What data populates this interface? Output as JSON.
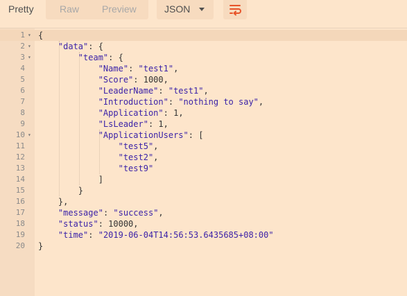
{
  "toolbar": {
    "tabs": [
      "Pretty",
      "Raw",
      "Preview"
    ],
    "format": "JSON",
    "wrap_icon": "wrap-lines-icon"
  },
  "lines": [
    {
      "n": "1",
      "fold": true,
      "text": "{"
    },
    {
      "n": "2",
      "fold": true,
      "text": "    \"data\": {"
    },
    {
      "n": "3",
      "fold": true,
      "text": "        \"team\": {"
    },
    {
      "n": "4",
      "fold": false,
      "text": "            \"Name\": \"test1\","
    },
    {
      "n": "5",
      "fold": false,
      "text": "            \"Score\": 1000,"
    },
    {
      "n": "6",
      "fold": false,
      "text": "            \"LeaderName\": \"test1\","
    },
    {
      "n": "7",
      "fold": false,
      "text": "            \"Introduction\": \"nothing to say\","
    },
    {
      "n": "8",
      "fold": false,
      "text": "            \"Application\": 1,"
    },
    {
      "n": "9",
      "fold": false,
      "text": "            \"LsLeader\": 1,"
    },
    {
      "n": "10",
      "fold": true,
      "text": "            \"ApplicationUsers\": ["
    },
    {
      "n": "11",
      "fold": false,
      "text": "                \"test5\","
    },
    {
      "n": "12",
      "fold": false,
      "text": "                \"test2\","
    },
    {
      "n": "13",
      "fold": false,
      "text": "                \"test9\""
    },
    {
      "n": "14",
      "fold": false,
      "text": "            ]"
    },
    {
      "n": "15",
      "fold": false,
      "text": "        }"
    },
    {
      "n": "16",
      "fold": false,
      "text": "    },"
    },
    {
      "n": "17",
      "fold": false,
      "text": "    \"message\": \"success\","
    },
    {
      "n": "18",
      "fold": false,
      "text": "    \"status\": 10000,"
    },
    {
      "n": "19",
      "fold": false,
      "text": "    \"time\": \"2019-06-04T14:56:53.6435685+08:00\""
    },
    {
      "n": "20",
      "fold": false,
      "text": "}"
    }
  ],
  "colors": {
    "background": "#fde5cb",
    "gutter": "#f6dcc2",
    "string": "#3b23a8",
    "accent": "#e8542a"
  }
}
